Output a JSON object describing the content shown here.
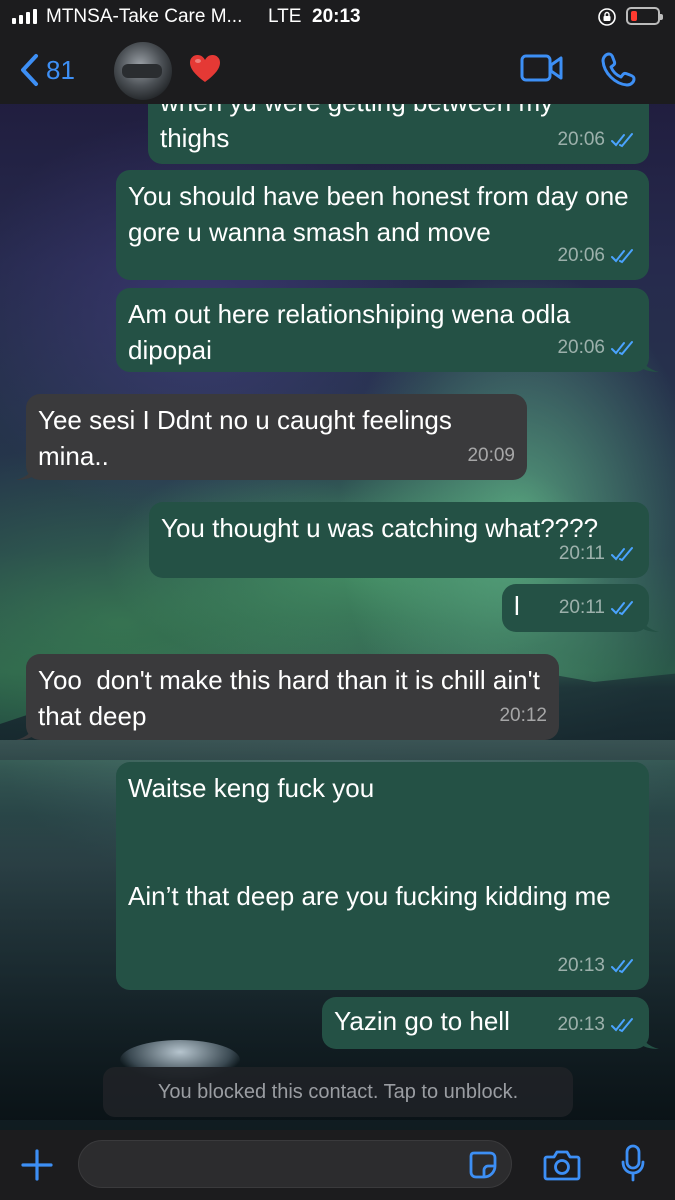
{
  "status_bar": {
    "carrier": "MTNSA-Take Care M...",
    "network": "LTE",
    "time": "20:13",
    "battery_level": 0.12
  },
  "header": {
    "back_count": "81",
    "contact_emoji": "❤️",
    "icons": {
      "back": "chevron-left-icon",
      "video": "video-call-icon",
      "phone": "phone-call-icon"
    }
  },
  "messages": [
    {
      "dir": "out",
      "text": "when yu were getting between my\nthighs",
      "time": "20:06",
      "read": true
    },
    {
      "dir": "out",
      "text": "You should have been honest from day one gore u wanna smash and move",
      "time": "20:06",
      "read": true
    },
    {
      "dir": "out",
      "text": "Am out here relationshiping wena odla dipopai",
      "time": "20:06",
      "read": true
    },
    {
      "dir": "in",
      "text": "Yee sesi I Ddnt no u caught feelings mina..",
      "time": "20:09"
    },
    {
      "dir": "out",
      "text": "You thought u was catching what????",
      "time": "20:11",
      "read": true
    },
    {
      "dir": "out",
      "text": "l",
      "time": "20:11",
      "read": true
    },
    {
      "dir": "in",
      "text": "Yoo  don't make this hard than it is chill ain't that deep",
      "time": "20:12"
    },
    {
      "dir": "out",
      "text": "Waitse keng fuck you\n\n\nAin’t that deep are you fucking kidding me",
      "time": "20:13",
      "read": true
    },
    {
      "dir": "out",
      "text": "Yazin go to hell",
      "time": "20:13",
      "read": true
    }
  ],
  "blocked_notice": "You blocked this contact. Tap to unblock.",
  "composer": {
    "input_value": "",
    "icons": [
      "plus-icon",
      "sticker-icon",
      "camera-icon",
      "microphone-icon"
    ]
  },
  "colors": {
    "outgoing_bubble": "#245145",
    "incoming_bubble": "#3a3a3c",
    "accent": "#3d8ff5"
  }
}
